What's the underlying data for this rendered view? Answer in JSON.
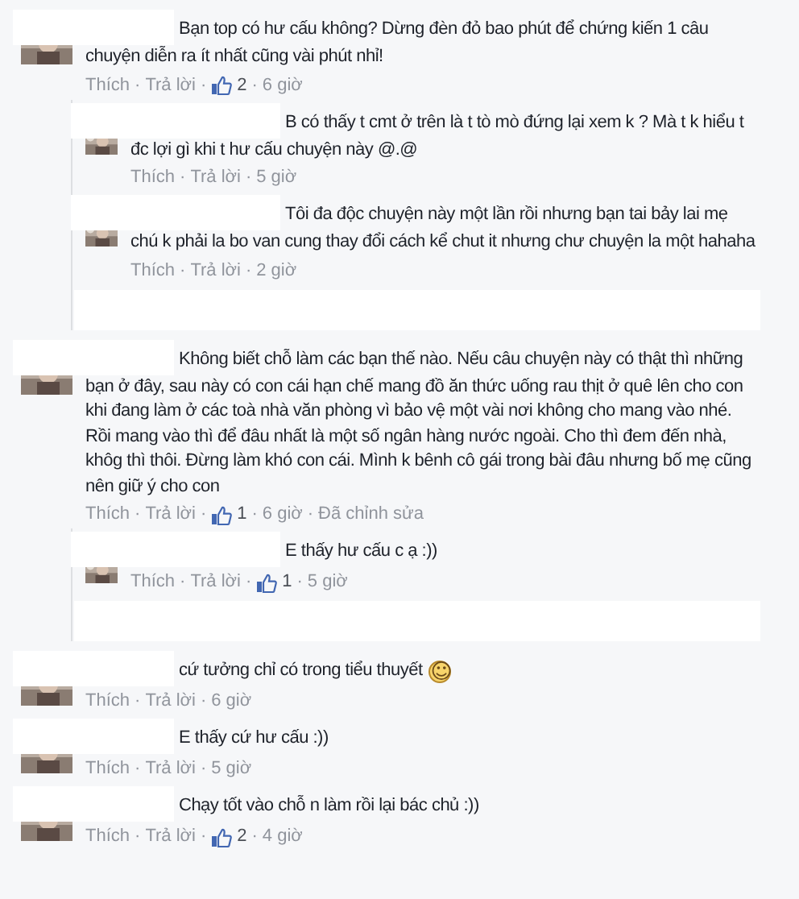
{
  "comments": [
    {
      "text": "Bạn top có hư cấu không? Dừng đèn đỏ bao phút để chứng kiến 1 câu chuyện diễn ra ít nhất cũng vài phút nhỉ!",
      "meta": [
        {
          "kind": "like",
          "text": "Thích"
        },
        {
          "kind": "dot",
          "text": "·"
        },
        {
          "kind": "reply",
          "text": "Trả lời"
        },
        {
          "kind": "dot",
          "text": "·"
        },
        {
          "kind": "likes",
          "text": "2"
        },
        {
          "kind": "dot",
          "text": "·"
        },
        {
          "kind": "time",
          "text": "6 giờ"
        }
      ],
      "reply_area_covered": true,
      "replies": [
        {
          "text": "B có thấy t cmt ở trên là t tò mò đứng lại xem k ? Mà t k hiểu t đc lợi gì khi t hư cấu chuyện này @.@",
          "meta": [
            {
              "kind": "like",
              "text": "Thích"
            },
            {
              "kind": "dot",
              "text": "·"
            },
            {
              "kind": "reply",
              "text": "Trả lời"
            },
            {
              "kind": "dot",
              "text": "·"
            },
            {
              "kind": "time",
              "text": "5 giờ"
            }
          ]
        },
        {
          "text": "Tôi đa độc chuyện này một lần rồi nhưng bạn tai bảy lai mẹ chú k phải la bo van cung thay đổi cách kể chut it nhưng chư chuyện la một hahaha",
          "meta": [
            {
              "kind": "like",
              "text": "Thích"
            },
            {
              "kind": "dot",
              "text": "·"
            },
            {
              "kind": "reply",
              "text": "Trả lời"
            },
            {
              "kind": "dot",
              "text": "·"
            },
            {
              "kind": "time",
              "text": "2 giờ"
            }
          ]
        }
      ]
    },
    {
      "text": "Không biết chỗ làm các bạn thế nào. Nếu câu chuyện này có thật thì những bạn ở đây, sau này có con cái hạn chế mang đồ ăn thức uống rau thịt ở quê lên cho con khi đang làm ở các toà nhà văn phòng vì bảo vệ một vài nơi không cho mang vào nhé. Rồi mang vào thì để đâu nhất là một số ngân hàng nước ngoài. Cho thì đem đến nhà, khôg thì thôi. Đừng làm khó con cái. Mình k bênh cô gái trong bài đâu nhưng bố mẹ cũng nên giữ ý cho con",
      "meta": [
        {
          "kind": "like",
          "text": "Thích"
        },
        {
          "kind": "dot",
          "text": "·"
        },
        {
          "kind": "reply",
          "text": "Trả lời"
        },
        {
          "kind": "dot",
          "text": "·"
        },
        {
          "kind": "likes",
          "text": "1"
        },
        {
          "kind": "dot",
          "text": "·"
        },
        {
          "kind": "time",
          "text": "6 giờ"
        },
        {
          "kind": "dot",
          "text": "·"
        },
        {
          "kind": "edited",
          "text": "Đã chỉnh sửa"
        }
      ],
      "reply_area_covered": true,
      "replies": [
        {
          "text": "E thấy hư cấu c ạ :))",
          "meta": [
            {
              "kind": "like",
              "text": "Thích"
            },
            {
              "kind": "dot",
              "text": "·"
            },
            {
              "kind": "reply",
              "text": "Trả lời"
            },
            {
              "kind": "dot",
              "text": "·"
            },
            {
              "kind": "likes",
              "text": "1"
            },
            {
              "kind": "dot",
              "text": "·"
            },
            {
              "kind": "time",
              "text": "5 giờ"
            }
          ]
        }
      ]
    },
    {
      "text": "cứ tưởng chỉ có trong tiểu thuyết",
      "emoji": "☺",
      "meta": [
        {
          "kind": "like",
          "text": "Thích"
        },
        {
          "kind": "dot",
          "text": "·"
        },
        {
          "kind": "reply",
          "text": "Trả lời"
        },
        {
          "kind": "dot",
          "text": "·"
        },
        {
          "kind": "time",
          "text": "6 giờ"
        }
      ]
    },
    {
      "text": "E thấy cứ hư cấu :))",
      "meta": [
        {
          "kind": "like",
          "text": "Thích"
        },
        {
          "kind": "dot",
          "text": "·"
        },
        {
          "kind": "reply",
          "text": "Trả lời"
        },
        {
          "kind": "dot",
          "text": "·"
        },
        {
          "kind": "time",
          "text": "5 giờ"
        }
      ]
    },
    {
      "text": "Chạy tốt vào chỗ n làm rồi lại bác chủ :))",
      "meta": [
        {
          "kind": "like",
          "text": "Thích"
        },
        {
          "kind": "dot",
          "text": "·"
        },
        {
          "kind": "reply",
          "text": "Trả lời"
        },
        {
          "kind": "dot",
          "text": "·"
        },
        {
          "kind": "likes",
          "text": "2"
        },
        {
          "kind": "dot",
          "text": "·"
        },
        {
          "kind": "time",
          "text": "4 giờ"
        }
      ]
    }
  ]
}
